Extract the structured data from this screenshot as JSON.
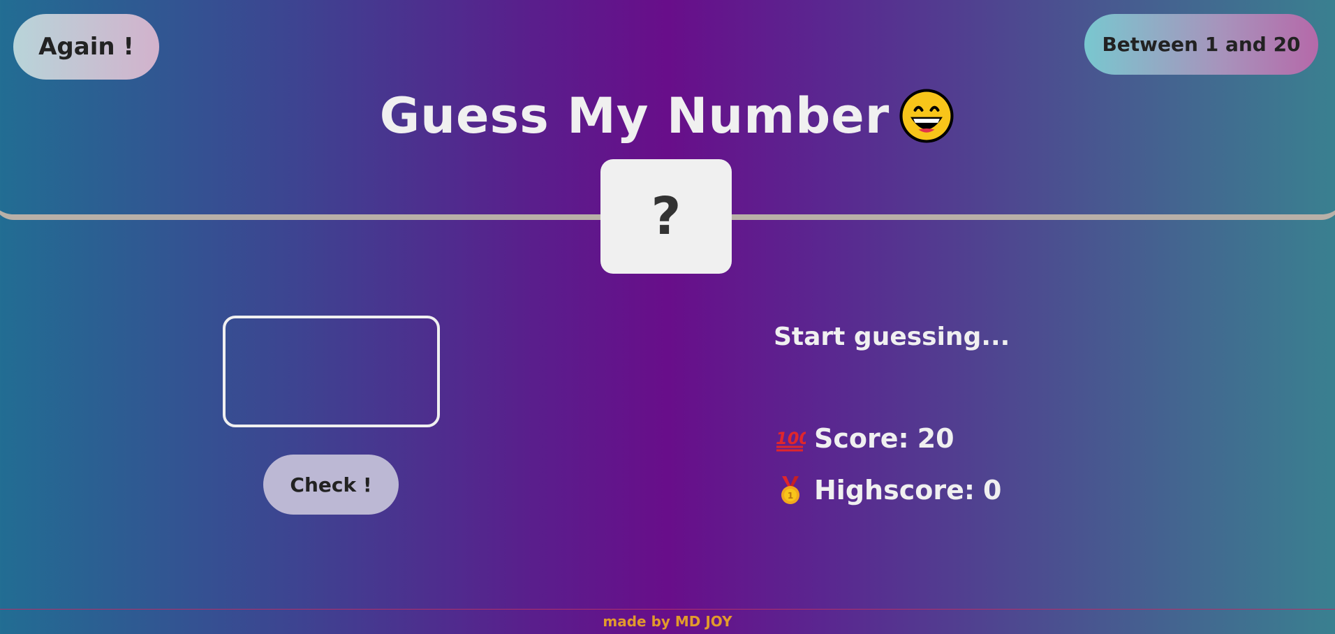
{
  "app": {
    "title": "Guess My Number"
  },
  "header": {
    "again_label": "Again !",
    "range_label": "Between 1 and 20",
    "title": "Guess My Number",
    "title_icon": "grinning-face-emoji",
    "secret_number": "?"
  },
  "main": {
    "guess_input": {
      "value": "",
      "placeholder": ""
    },
    "check_label": "Check !",
    "message": "Start guessing...",
    "score": {
      "icon": "hundred-points-emoji",
      "label": "Score:",
      "value": "20"
    },
    "highscore": {
      "icon": "medal-emoji",
      "label": "Highscore:",
      "value": "0"
    }
  },
  "footer": {
    "text": "made by MD JOY"
  },
  "colors": {
    "background_left": "#226d93",
    "background_center": "#680e8a",
    "background_right": "#3a8090",
    "text_light": "#f0f0f0",
    "footer_text": "#e29b2c",
    "divider": "#b9b0a8"
  }
}
